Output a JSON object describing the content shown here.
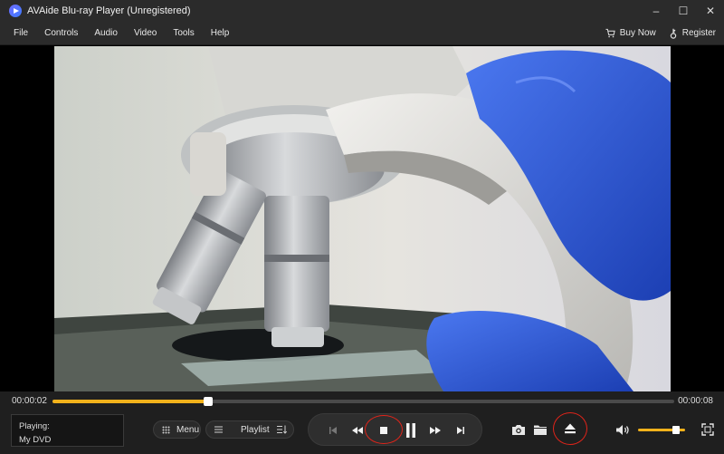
{
  "window": {
    "title": "AVAide Blu-ray Player (Unregistered)",
    "minimize_glyph": "–",
    "maximize_glyph": "☐",
    "close_glyph": "✕"
  },
  "menu": {
    "items": [
      "File",
      "Controls",
      "Audio",
      "Video",
      "Tools",
      "Help"
    ],
    "buy_now": "Buy Now",
    "register": "Register"
  },
  "player": {
    "current_time": "00:00:02",
    "duration": "00:00:08",
    "progress_fraction": 0.25,
    "volume_fraction": 0.8,
    "status_label": "Playing:",
    "status_value": "My DVD",
    "menu_button": "Menu",
    "playlist_button": "Playlist"
  },
  "icons": {
    "app": "app-logo-icon",
    "cart": "cart-icon",
    "key": "key-icon",
    "menu": "grid-menu-icon",
    "playlist": "list-icon",
    "sort": "sort-icon",
    "prev": "previous-icon",
    "rewind": "rewind-icon",
    "stop": "stop-icon",
    "pause": "pause-icon",
    "forward": "fast-forward-icon",
    "next": "next-icon",
    "snapshot": "camera-icon",
    "folder": "folder-icon",
    "eject": "eject-icon",
    "volume": "volume-icon",
    "fullscreen": "fullscreen-icon"
  },
  "colors": {
    "accent": "#f2b21b",
    "highlight_ring": "#e0241a",
    "chrome": "#2b2b2b",
    "control_bar": "#1f1f1f"
  }
}
